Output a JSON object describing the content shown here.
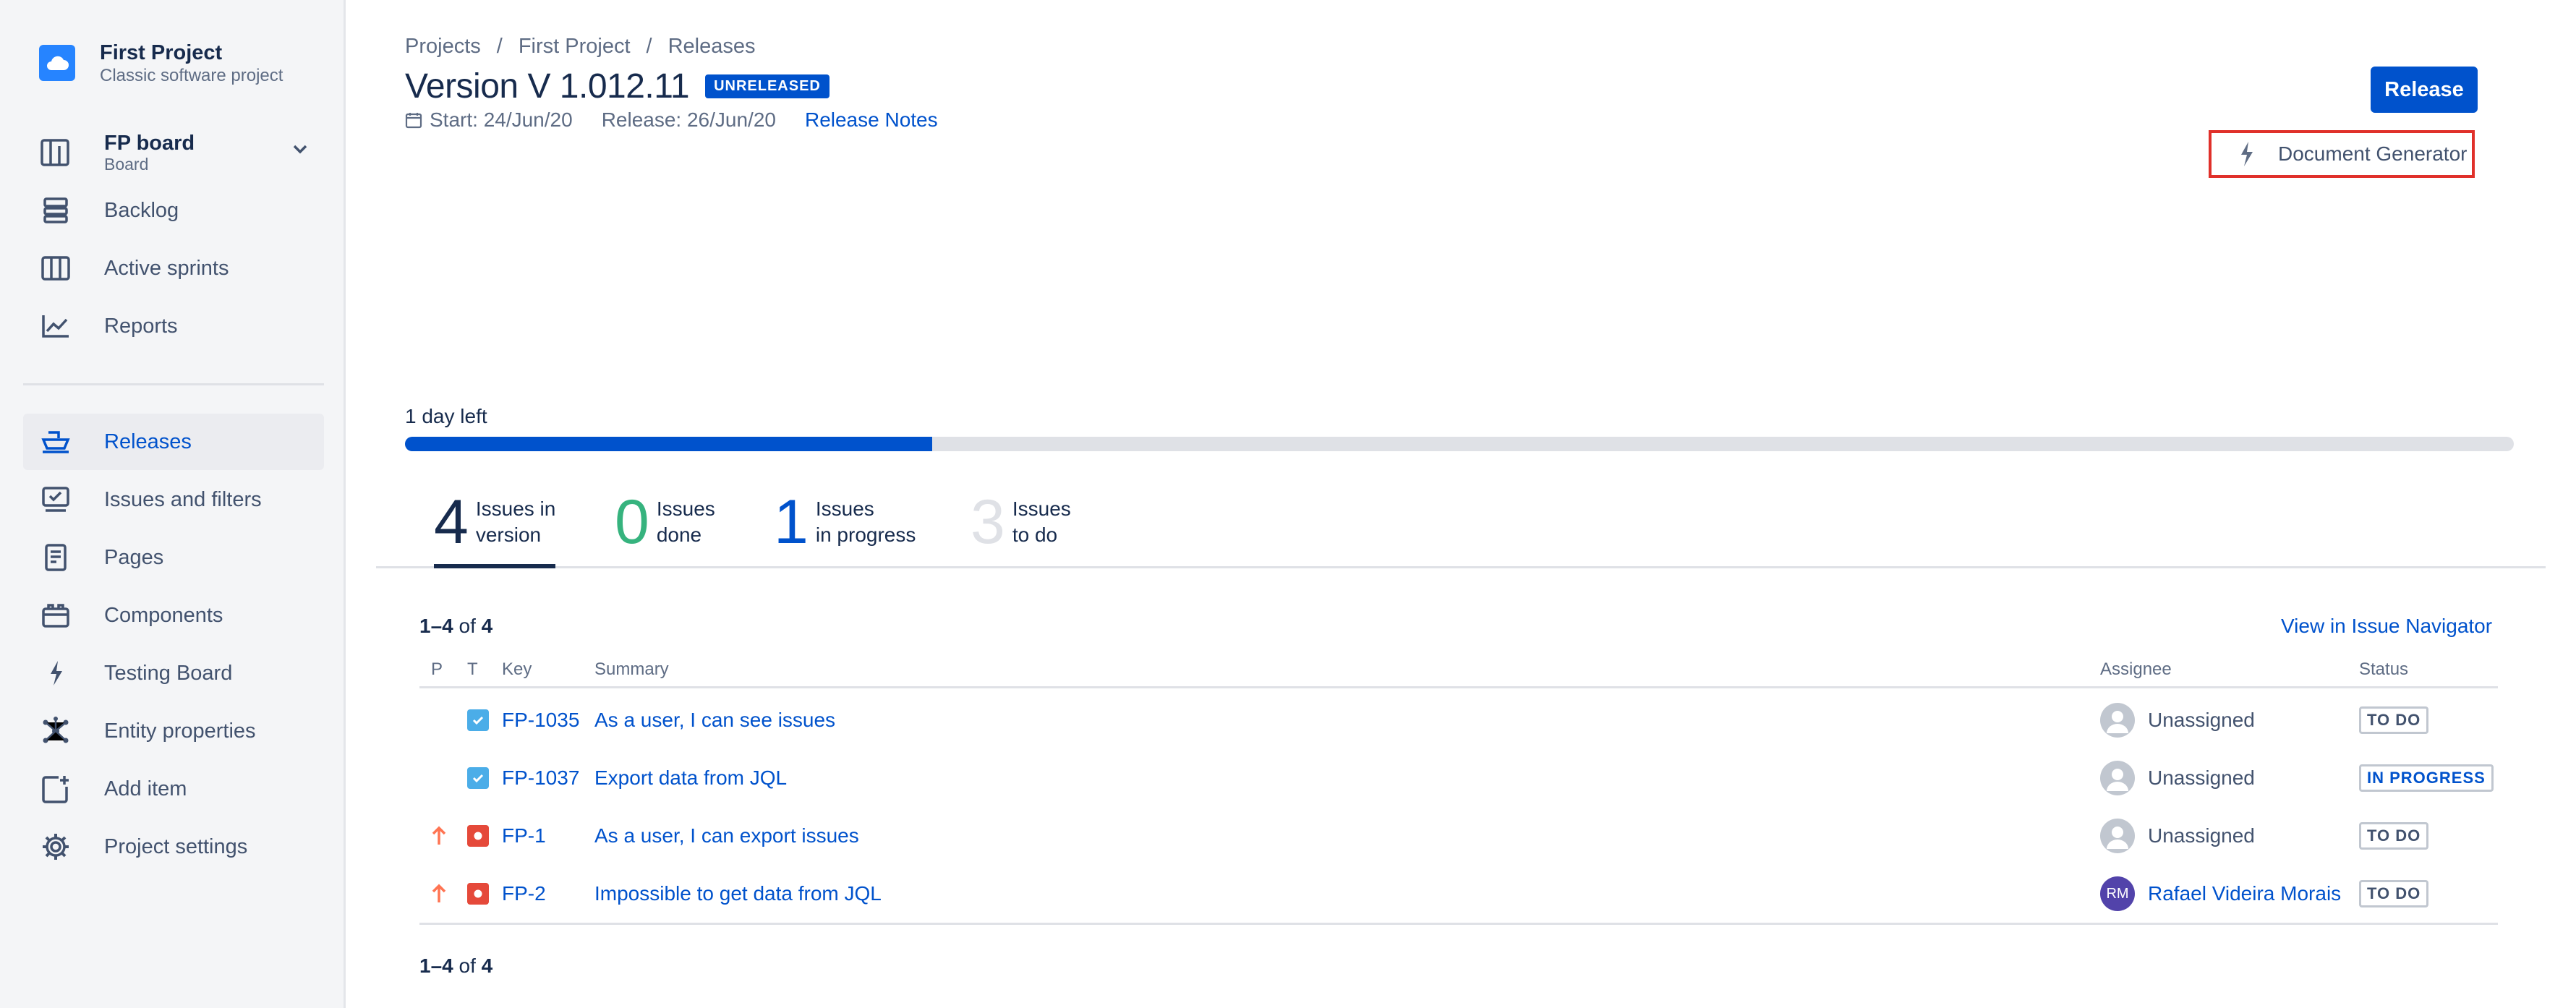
{
  "sidebar": {
    "project_name": "First Project",
    "project_type": "Classic software project",
    "board": {
      "title": "FP board",
      "subtitle": "Board"
    },
    "items": [
      {
        "label": "Backlog"
      },
      {
        "label": "Active sprints"
      },
      {
        "label": "Reports"
      },
      {
        "label": "Releases"
      },
      {
        "label": "Issues and filters"
      },
      {
        "label": "Pages"
      },
      {
        "label": "Components"
      },
      {
        "label": "Testing Board"
      },
      {
        "label": "Entity properties"
      },
      {
        "label": "Add item"
      },
      {
        "label": "Project settings"
      }
    ]
  },
  "breadcrumb": [
    "Projects",
    "/",
    "First Project",
    "/",
    "Releases"
  ],
  "version": {
    "title": "Version V 1.012.11",
    "badge": "UNRELEASED",
    "start": "Start: 24/Jun/20",
    "release": "Release: 26/Jun/20",
    "notes_link": "Release Notes"
  },
  "actions": {
    "release_label": "Release",
    "docgen_label": "Document Generator"
  },
  "progress": {
    "label": "1 day left",
    "fraction": 0.25
  },
  "tabs": [
    {
      "num": "4",
      "line1": "Issues in",
      "line2": "version",
      "color": "#172b4d"
    },
    {
      "num": "0",
      "line1": "Issues",
      "line2": "done",
      "color": "#36b37e"
    },
    {
      "num": "1",
      "line1": "Issues",
      "line2": "in progress",
      "color": "#0052cc"
    },
    {
      "num": "3",
      "line1": "Issues",
      "line2": "to do",
      "color": "#dfe1e6"
    }
  ],
  "count": {
    "range": "1–4",
    "of": "of",
    "total": "4"
  },
  "view_navigator": "View in Issue Navigator",
  "table": {
    "headers": {
      "p": "P",
      "t": "T",
      "key": "Key",
      "summary": "Summary",
      "assignee": "Assignee",
      "status": "Status"
    },
    "rows": [
      {
        "priority": "",
        "type": "story",
        "key": "FP-1035",
        "summary": "As a user, I can see issues",
        "assignee": "Unassigned",
        "avatar": "",
        "status": "TO DO"
      },
      {
        "priority": "",
        "type": "story",
        "key": "FP-1037",
        "summary": "Export data from JQL",
        "assignee": "Unassigned",
        "avatar": "",
        "status": "IN PROGRESS"
      },
      {
        "priority": "high",
        "type": "bug",
        "key": "FP-1",
        "summary": "As a user, I can export issues",
        "assignee": "Unassigned",
        "avatar": "",
        "status": "TO DO"
      },
      {
        "priority": "high",
        "type": "bug",
        "key": "FP-2",
        "summary": "Impossible to get data from JQL",
        "assignee": "Rafael Videira Morais",
        "avatar": "RM",
        "status": "TO DO"
      }
    ]
  }
}
